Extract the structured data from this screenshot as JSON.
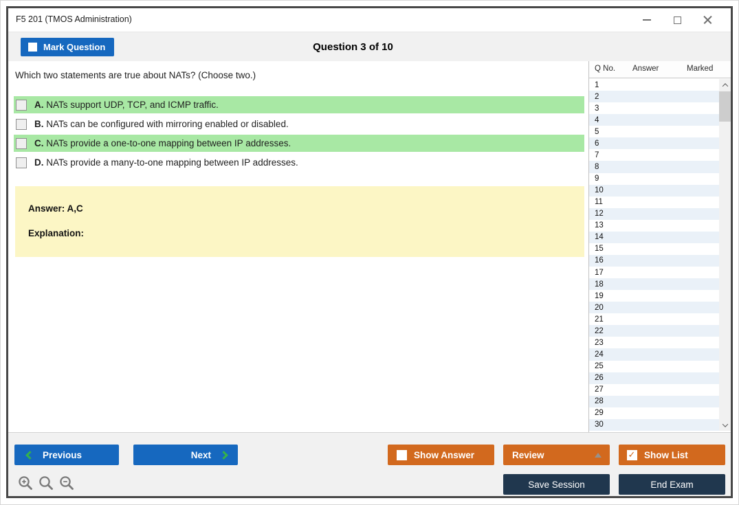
{
  "window": {
    "title": "F5 201 (TMOS Administration)"
  },
  "toolbar": {
    "mark_question_label": "Mark Question",
    "question_counter": "Question 3 of 10"
  },
  "question": {
    "text": "Which two statements are true about NATs? (Choose two.)",
    "options": [
      {
        "letter": "A.",
        "text": "NATs support UDP, TCP, and ICMP traffic.",
        "highlighted": true,
        "checked": false
      },
      {
        "letter": "B.",
        "text": "NATs can be configured with mirroring enabled or disabled.",
        "highlighted": false,
        "checked": false
      },
      {
        "letter": "C.",
        "text": "NATs provide a one-to-one mapping between IP addresses.",
        "highlighted": true,
        "checked": false
      },
      {
        "letter": "D.",
        "text": "NATs provide a many-to-one mapping between IP addresses.",
        "highlighted": false,
        "checked": false
      }
    ],
    "answer_text": "Answer: A,C",
    "explanation_label": "Explanation:"
  },
  "question_list": {
    "columns": [
      "Q No.",
      "Answer",
      "Marked"
    ],
    "visible_rows": [
      "1",
      "2",
      "3",
      "4",
      "5",
      "6",
      "7",
      "8",
      "9",
      "10",
      "11",
      "12",
      "13",
      "14",
      "15",
      "16",
      "17",
      "18",
      "19",
      "20",
      "21",
      "22",
      "23",
      "24",
      "25",
      "26",
      "27",
      "28",
      "29",
      "30"
    ]
  },
  "footer": {
    "previous": "Previous",
    "next": "Next",
    "show_answer": "Show Answer",
    "show_answer_checked": false,
    "review": "Review",
    "show_list": "Show List",
    "show_list_checked": true,
    "save_session": "Save Session",
    "end_exam": "End Exam"
  },
  "colors": {
    "blue": "#1668bf",
    "orange": "#d2691e",
    "navy": "#20374e",
    "highlight_green": "#a8e8a4",
    "answer_yellow": "#fcf6c5",
    "alt_row_blue": "#eaf1f8",
    "strip_gray": "#f1f1f1",
    "border_dark": "#474747"
  }
}
